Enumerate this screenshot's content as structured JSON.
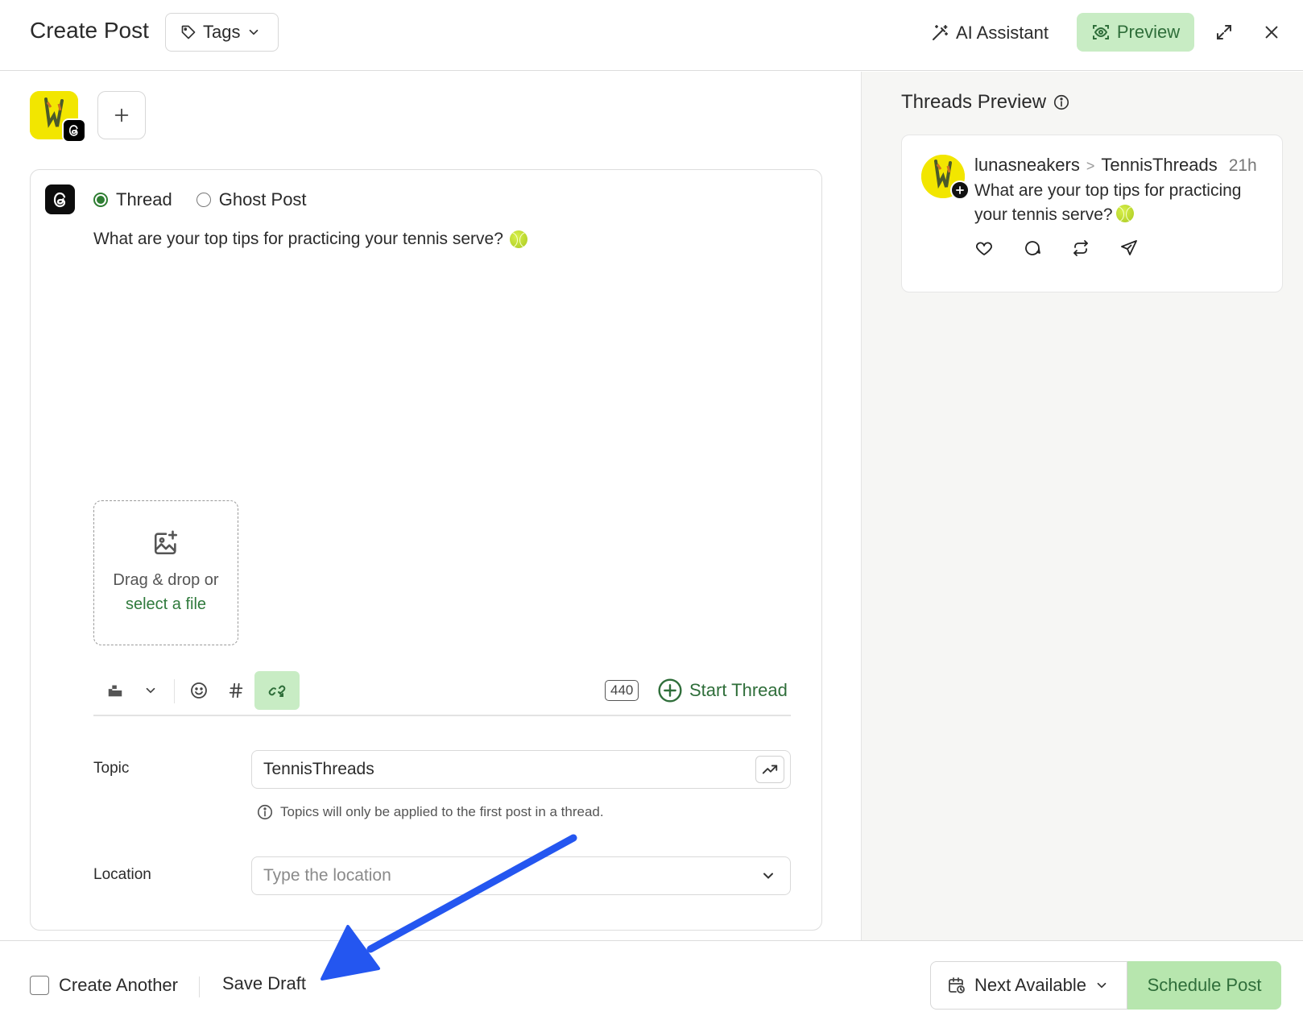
{
  "header": {
    "title": "Create Post",
    "tags_label": "Tags",
    "ai_assistant_label": "AI Assistant",
    "preview_label": "Preview"
  },
  "editor": {
    "post_types": [
      {
        "label": "Thread",
        "selected": true
      },
      {
        "label": "Ghost Post",
        "selected": false
      }
    ],
    "post_text": "What are your top tips for practicing your tennis serve?",
    "dropzone": {
      "text": "Drag & drop or",
      "link": "select a file"
    },
    "char_count": "440",
    "start_thread_label": "Start Thread",
    "topic": {
      "label": "Topic",
      "value": "TennisThreads",
      "note": "Topics will only be applied to the first post in a thread."
    },
    "location": {
      "label": "Location",
      "placeholder": "Type the location"
    }
  },
  "preview": {
    "title": "Threads Preview",
    "username": "lunasneakers",
    "separator": ">",
    "topic": "TennisThreads",
    "time": "21h",
    "text": "What are your top tips for practicing your tennis serve?"
  },
  "footer": {
    "create_another_label": "Create Another",
    "save_draft_label": "Save Draft",
    "next_available_label": "Next Available",
    "schedule_label": "Schedule Post"
  },
  "colors": {
    "accent_green": "#2f6e3a",
    "light_green": "#c8ecc4",
    "arrow_blue": "#2456f0",
    "avatar_yellow": "#f2e600"
  },
  "icons": [
    "tag-icon",
    "chevron-down-icon",
    "magic-wand-icon",
    "eye-icon",
    "expand-icon",
    "close-icon",
    "threads-icon",
    "plus-icon",
    "image-plus-icon",
    "buffer-icon",
    "emoji-icon",
    "hashtag-icon",
    "unlink-icon",
    "plus-circle-icon",
    "trending-icon",
    "info-icon",
    "heart-icon",
    "comment-icon",
    "repost-icon",
    "send-icon",
    "calendar-clock-icon"
  ]
}
